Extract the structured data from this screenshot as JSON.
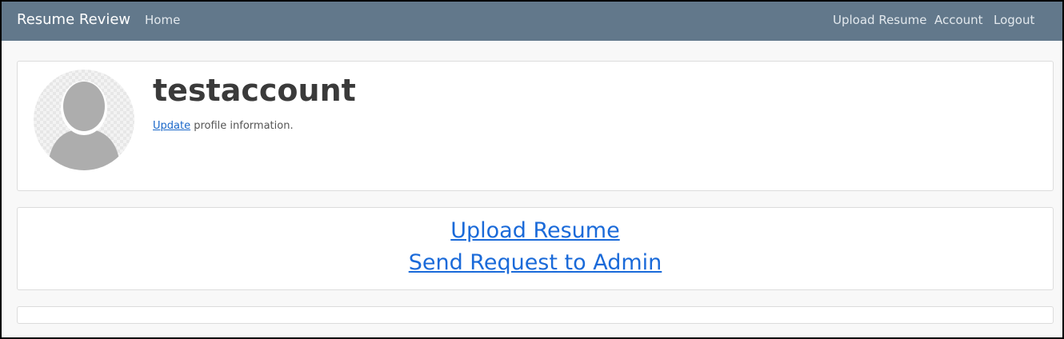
{
  "navbar": {
    "brand": "Resume Review",
    "home": "Home",
    "upload_resume": "Upload Resume",
    "account": "Account",
    "logout": "Logout",
    "bg_color": "#62788b"
  },
  "profile": {
    "username": "testaccount",
    "update_link": "Update",
    "update_suffix": " profile information.",
    "avatar_icon": "default-user-avatar"
  },
  "actions": {
    "upload_resume": "Upload Resume",
    "send_request": "Send Request to Admin",
    "link_color": "#1a6ad9"
  }
}
